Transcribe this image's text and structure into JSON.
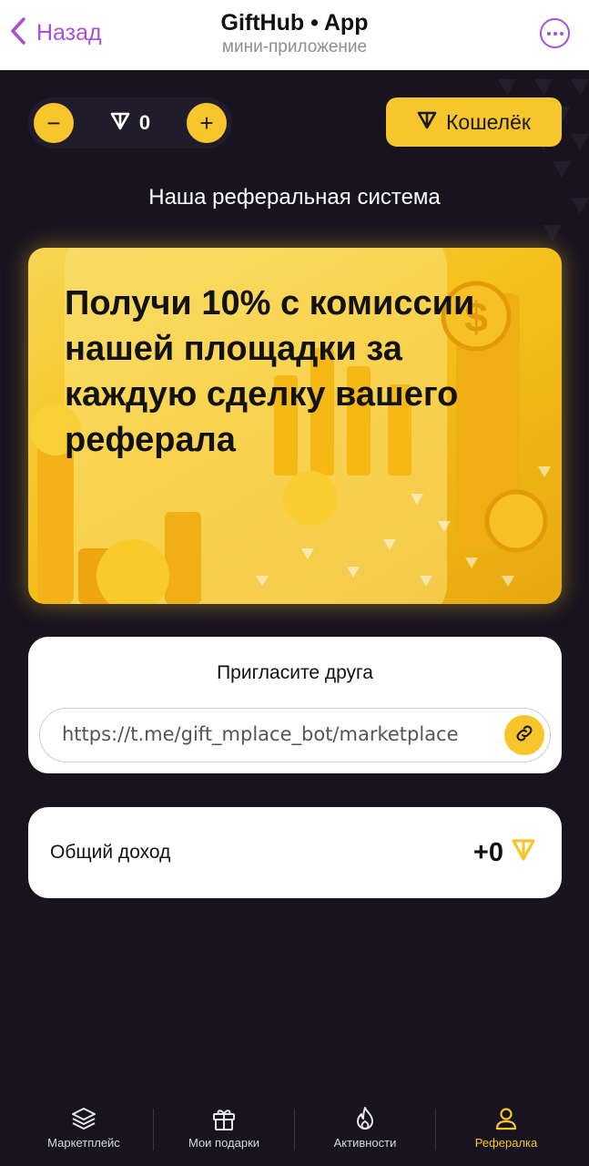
{
  "header": {
    "back_label": "Назад",
    "title": "GiftHub • App",
    "subtitle": "мини-приложение",
    "accent_color": "#a94fd8"
  },
  "balance": {
    "minus_label": "−",
    "plus_label": "+",
    "value": "0",
    "currency_icon": "ton-icon"
  },
  "wallet_button": {
    "label": "Кошелёк",
    "icon": "ton-icon"
  },
  "section_title": "Наша реферальная система",
  "promo": {
    "text": "Получи 10% с комиссии нашей площадки за каждую сделку вашего реферала"
  },
  "invite": {
    "title": "Пригласите друга",
    "link": "https://t.me/gift_mplace_bot/marketplace",
    "copy_icon": "link-icon"
  },
  "income": {
    "label": "Общий доход",
    "value": "+0",
    "currency_icon": "ton-icon"
  },
  "nav": {
    "items": [
      {
        "label": "Маркетплейс",
        "icon": "layers-icon",
        "active": false
      },
      {
        "label": "Мои подарки",
        "icon": "gift-icon",
        "active": false
      },
      {
        "label": "Активности",
        "icon": "flame-icon",
        "active": false
      },
      {
        "label": "Рефералка",
        "icon": "user-icon",
        "active": true
      }
    ]
  },
  "colors": {
    "background": "#17131f",
    "brand_yellow": "#f7c52c"
  }
}
